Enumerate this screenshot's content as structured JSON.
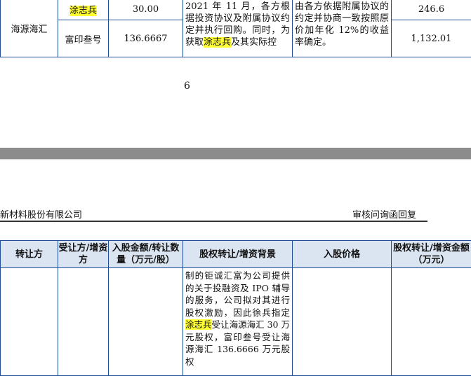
{
  "top_table": {
    "group": "海源海汇",
    "rows": [
      {
        "name": "涂志兵",
        "amount": "30.00",
        "price_value": "246.6"
      },
      {
        "name": "富印叁号",
        "amount": "136.6667",
        "price_value": "1,132.01"
      }
    ],
    "background_pre": "2021 年 11 月，各方根据投资协议及附属协议约定并执行回购。同时，为获取",
    "background_highlight": "涂志兵",
    "background_post": "及其实际控",
    "price": "由各方依据附属协议的约定并协商一致按照原价加年化 12%的收益率确定。"
  },
  "page_number": "6",
  "header": {
    "company": "新材料股份有限公司",
    "doc_title": "审核问询函回复"
  },
  "bottom_table": {
    "headers": [
      "转让方",
      "受让方/增资方",
      "入股金额/转让数量（万元/股）",
      "股权转让/增资背景",
      "入股价格",
      "股权转让/增资金额（万元）"
    ],
    "background_pre": "制的钜诚汇富为公司提供的关于投融资及 IPO 辅导的服务，公司拟对其进行股权激励，因此徐兵指定",
    "background_highlight": "涂志兵",
    "background_post": "受让海源海汇 30 万元股权，富印叁号受让海源海汇 136.6666 万元股权"
  }
}
